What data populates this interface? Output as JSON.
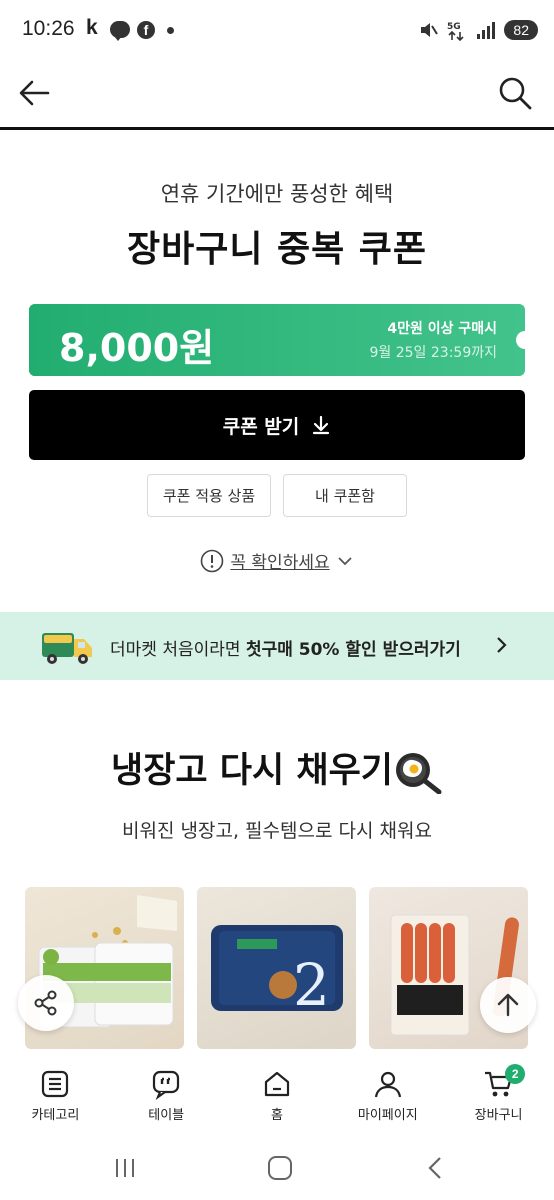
{
  "status_bar": {
    "time": "10:26",
    "notification_k": "k",
    "battery": "82",
    "network": "5G"
  },
  "header": {
    "back_icon": "arrow-left-icon",
    "search_icon": "search-icon"
  },
  "promo": {
    "subtitle": "연휴 기간에만 풍성한 혜택",
    "title": "장바구니 중복 쿠폰",
    "coupon": {
      "amount": "8,000원",
      "condition": "4만원 이상 구매시",
      "expire": "9월 25일 23:59까지"
    },
    "get_coupon_label": "쿠폰 받기",
    "products_button": "쿠폰 적용 상품",
    "my_coupons_button": "내 쿠폰함",
    "notice": "꼭 확인하세요"
  },
  "banner": {
    "text_prefix": "더마켓 처음이라면 ",
    "text_bold": "첫구매 50% 할인 받으러가기"
  },
  "section": {
    "title": "냉장고 다시 채우기",
    "subtitle": "비워진 냉장고, 필수템으로 다시 채워요"
  },
  "bottom_nav": {
    "items": [
      {
        "label": "카테고리",
        "icon": "category-icon"
      },
      {
        "label": "테이블",
        "icon": "chat-quote-icon"
      },
      {
        "label": "홈",
        "icon": "home-icon"
      },
      {
        "label": "마이페이지",
        "icon": "user-icon"
      },
      {
        "label": "장바구니",
        "icon": "cart-icon",
        "badge": "2"
      }
    ]
  },
  "colors": {
    "accent": "#22ad70",
    "banner_bg": "#d6f1e6",
    "primary_button": "#000000"
  }
}
